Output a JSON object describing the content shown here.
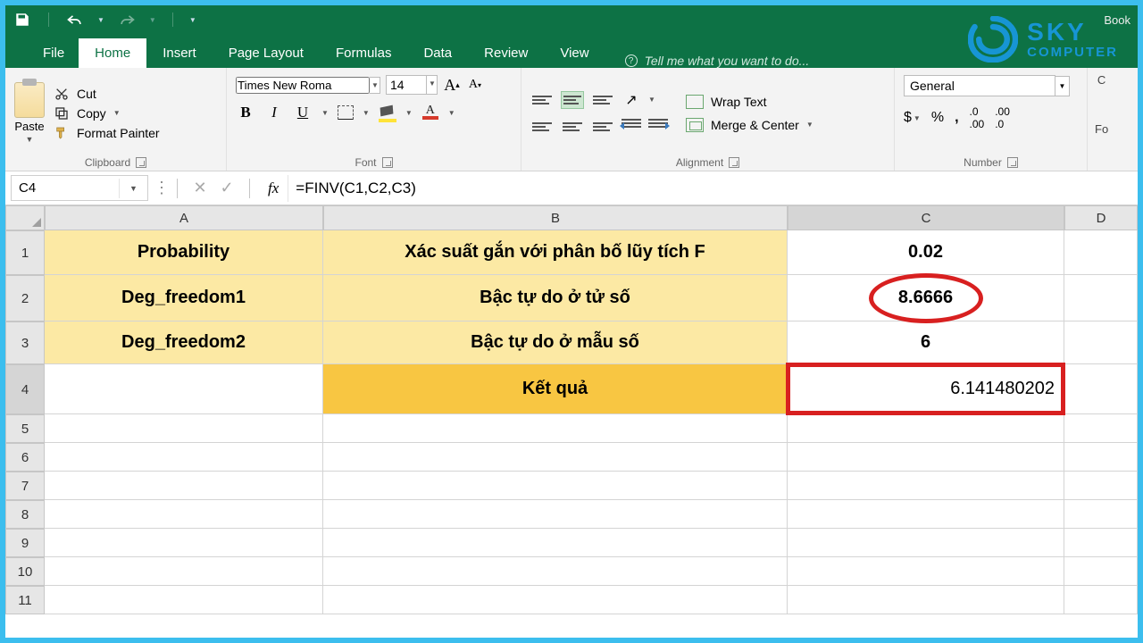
{
  "window": {
    "title_right": "Book"
  },
  "qat": {
    "save": "save",
    "undo": "undo",
    "redo": "redo"
  },
  "tabs": {
    "file": "File",
    "home": "Home",
    "insert": "Insert",
    "page_layout": "Page Layout",
    "formulas": "Formulas",
    "data": "Data",
    "review": "Review",
    "view": "View",
    "tell_me": "Tell me what you want to do..."
  },
  "logo": {
    "line1": "SKY",
    "line2": "COMPUTER"
  },
  "ribbon": {
    "clipboard": {
      "label": "Clipboard",
      "paste": "Paste",
      "cut": "Cut",
      "copy": "Copy",
      "format_painter": "Format Painter"
    },
    "font": {
      "label": "Font",
      "name": "Times New Roma",
      "size": "14",
      "grow": "A",
      "shrink": "A"
    },
    "alignment": {
      "label": "Alignment",
      "wrap": "Wrap Text",
      "merge": "Merge & Center"
    },
    "number": {
      "label": "Number",
      "format": "General",
      "currency": "$",
      "percent": "%",
      "comma": ",",
      "inc_dec": "",
      "dec_dec": ""
    },
    "more": {
      "c": "C",
      "fo": "Fo"
    }
  },
  "fbar": {
    "name": "C4",
    "cancel": "✕",
    "enter": "✓",
    "fx": "fx",
    "formula": "=FINV(C1,C2,C3)"
  },
  "columns": [
    "",
    "A",
    "B",
    "C",
    "D"
  ],
  "rows": {
    "1": {
      "A": "Probability",
      "B": "Xác suất gắn với phân bố lũy tích F",
      "C": "0.02"
    },
    "2": {
      "A": "Deg_freedom1",
      "B": "Bậc tự do ở tử số",
      "C": "8.6666"
    },
    "3": {
      "A": "Deg_freedom2",
      "B": "Bậc tự do ở mẫu số",
      "C": "6"
    },
    "4": {
      "A": "",
      "B": "Kết quả",
      "C": "6.141480202"
    }
  }
}
